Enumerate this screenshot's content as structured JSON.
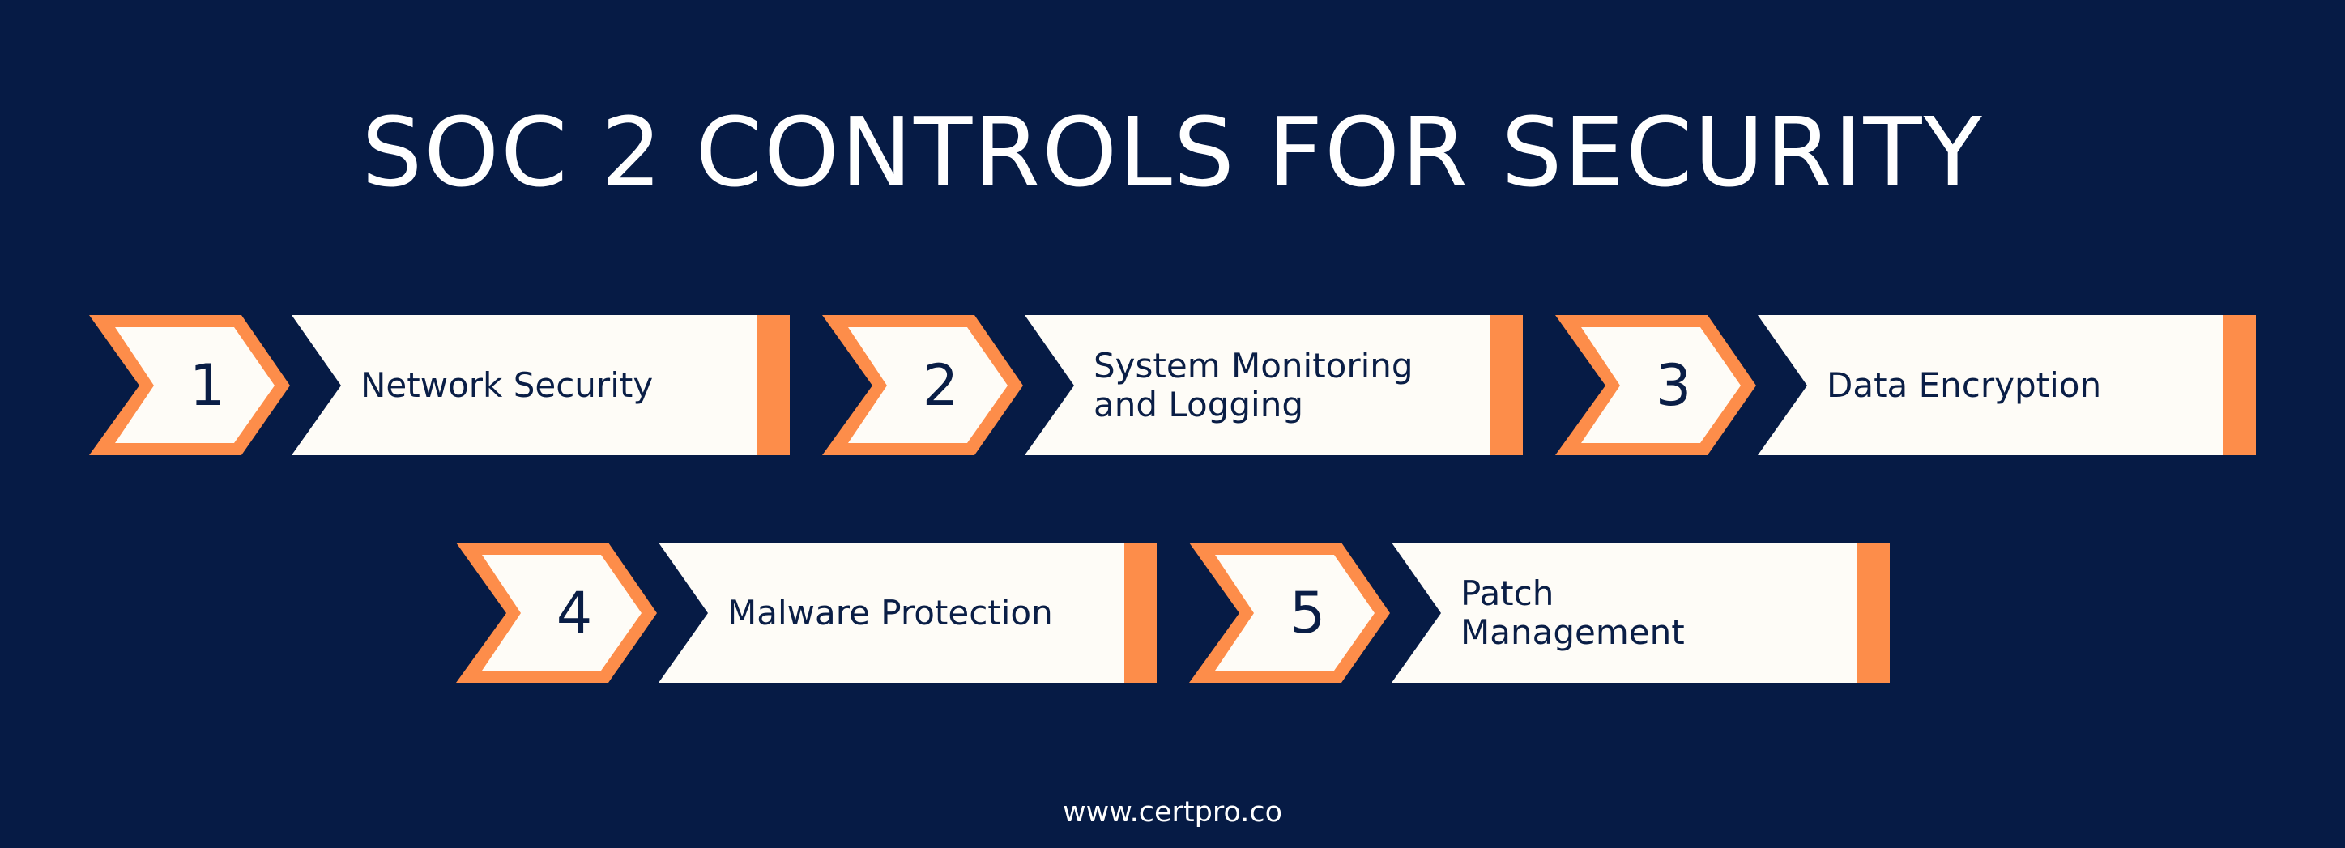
{
  "title": "SOC 2 CONTROLS FOR SECURITY",
  "colors": {
    "background": "#061b45",
    "accent": "#fd8d4a",
    "card": "#fefcf7",
    "text": "#0a1e46"
  },
  "steps": [
    {
      "number": "1",
      "label": "Network Security"
    },
    {
      "number": "2",
      "label": "System Monitoring\nand Logging"
    },
    {
      "number": "3",
      "label": "Data Encryption"
    },
    {
      "number": "4",
      "label": "Malware Protection"
    },
    {
      "number": "5",
      "label": "Patch\nManagement"
    }
  ],
  "footer": "www.certpro.co"
}
